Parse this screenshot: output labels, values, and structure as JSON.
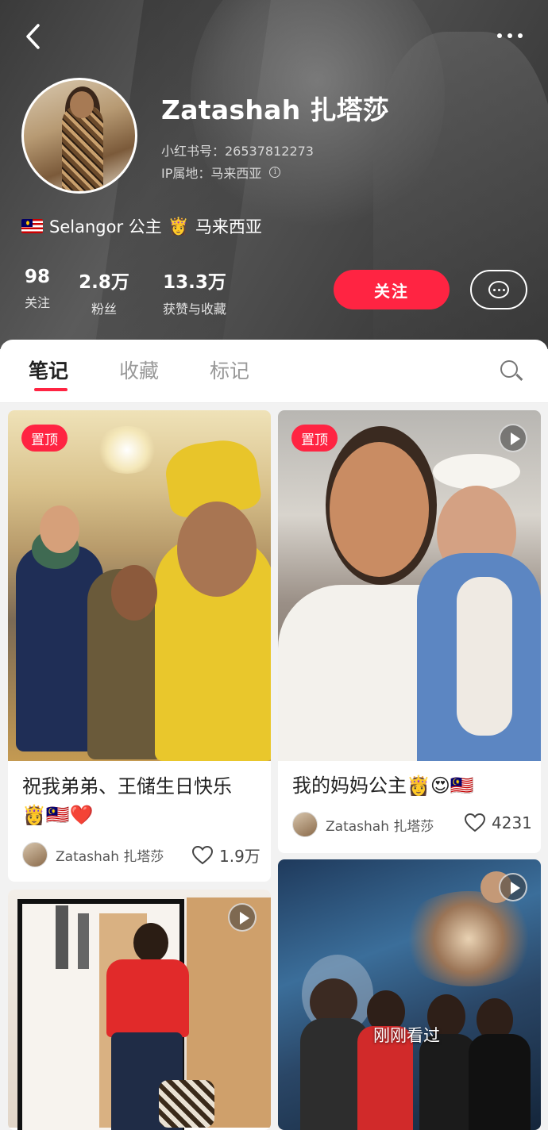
{
  "profile": {
    "name": "Zatashah 扎塔莎",
    "id_label": "小红书号：26537812273",
    "ip_label": "IP属地：马来西亚",
    "bio_text1": "Selangor 公主",
    "bio_text2": "马来西亚",
    "bio_emoji": "👸",
    "stats": [
      {
        "value": "98",
        "label": "关注"
      },
      {
        "value": "2.8万",
        "label": "粉丝"
      },
      {
        "value": "13.3万",
        "label": "获赞与收藏"
      }
    ],
    "follow_label": "关注"
  },
  "tabs": [
    {
      "label": "笔记",
      "active": true
    },
    {
      "label": "收藏",
      "active": false
    },
    {
      "label": "标记",
      "active": false
    }
  ],
  "notes": [
    {
      "pinned": true,
      "pin_label": "置顶",
      "title": "祝我弟弟、王储生日快乐",
      "title_emoji": "👸🇲🇾❤️",
      "author": "Zatashah 扎塔莎",
      "likes": "1.9万",
      "is_video": false
    },
    {
      "pinned": true,
      "pin_label": "置顶",
      "title": "我的妈妈公主👸😍🇲🇾",
      "author": "Zatashah 扎塔莎",
      "likes": "4231",
      "is_video": true
    },
    {
      "pinned": false,
      "is_video": true
    },
    {
      "pinned": false,
      "is_video": true,
      "overlay_label": "刚刚看过"
    }
  ],
  "colors": {
    "accent": "#ff2442",
    "header_bg": "#4a4a4a"
  },
  "icons": [
    "back-arrow-icon",
    "more-dots-icon",
    "info-icon",
    "chat-bubble-icon",
    "search-icon",
    "heart-icon",
    "play-icon"
  ]
}
